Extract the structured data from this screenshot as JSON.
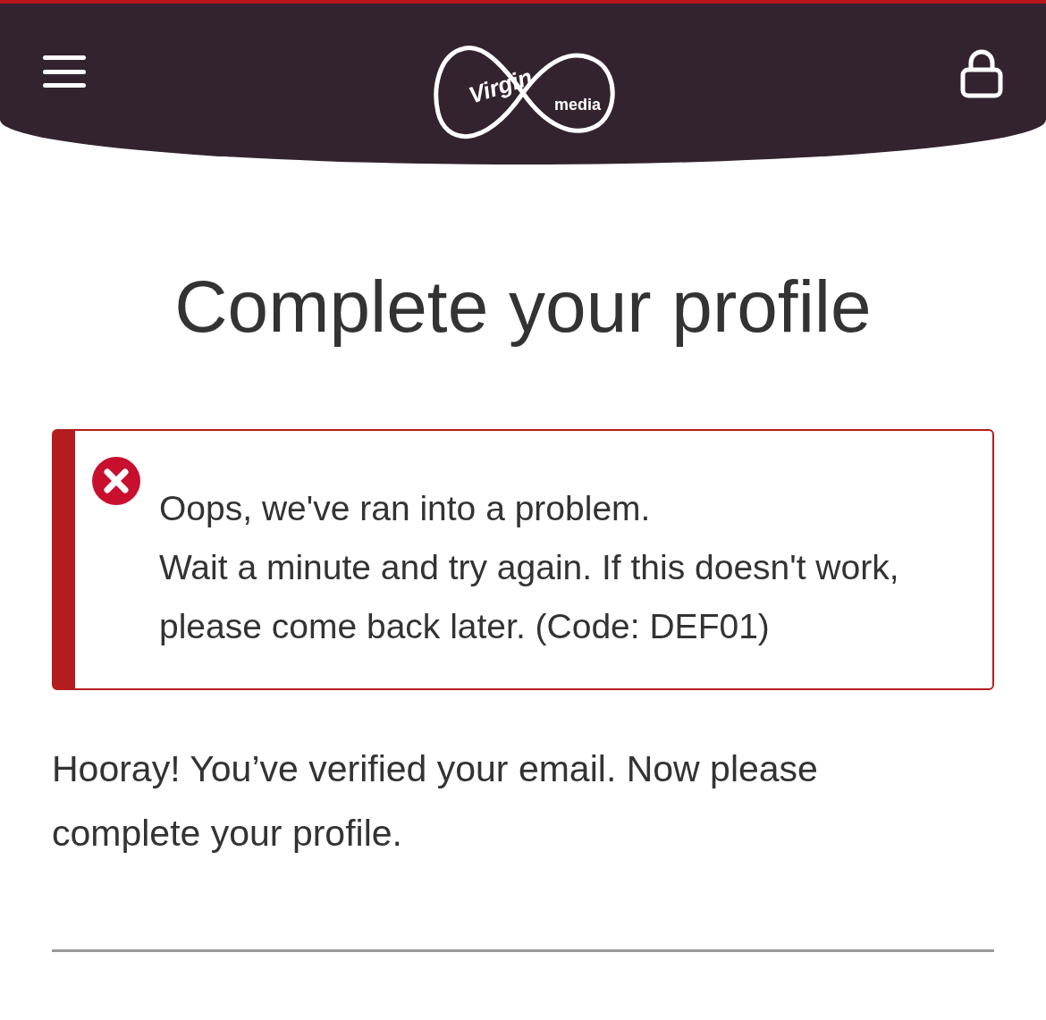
{
  "header": {
    "logo": {
      "primary": "Virgin",
      "secondary": "media"
    }
  },
  "title": "Complete your profile",
  "error": {
    "heading": "Oops, we've ran into a problem.",
    "message": "Wait a minute and try again. If this doesn't work, please come back later. (Code: DEF01)"
  },
  "intro": "Hooray! You’ve verified your email. Now please complete your profile."
}
